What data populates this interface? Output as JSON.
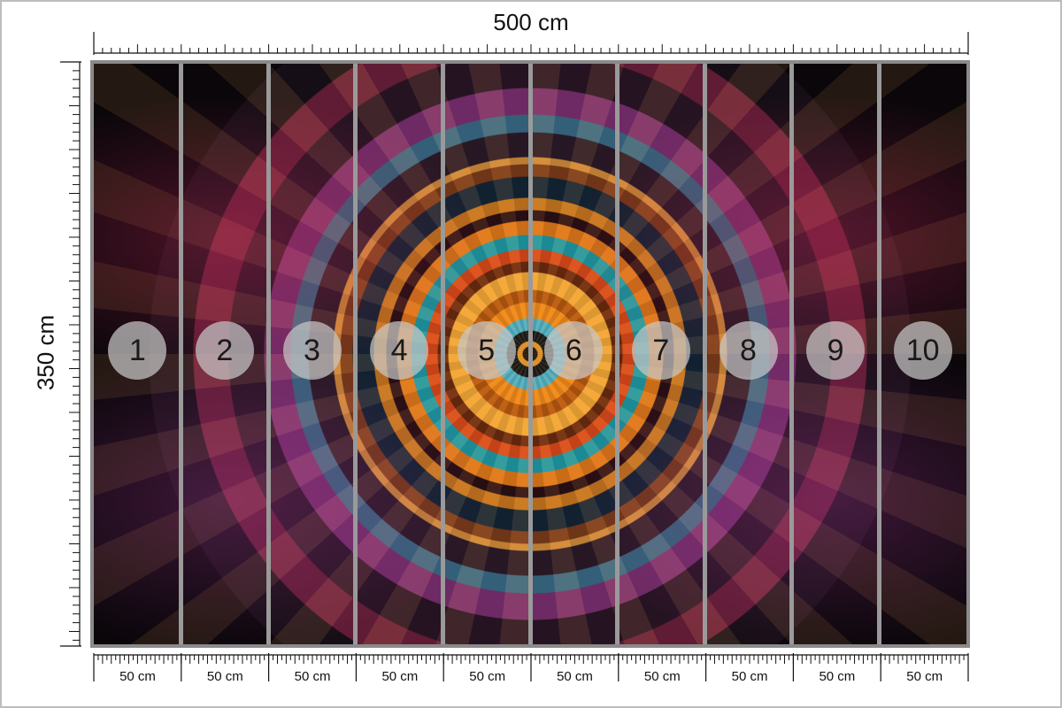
{
  "dimensions": {
    "width_label": "500 cm",
    "height_label": "350 cm"
  },
  "panels": [
    {
      "number": "1",
      "width_label": "50 cm"
    },
    {
      "number": "2",
      "width_label": "50 cm"
    },
    {
      "number": "3",
      "width_label": "50 cm"
    },
    {
      "number": "4",
      "width_label": "50 cm"
    },
    {
      "number": "5",
      "width_label": "50 cm"
    },
    {
      "number": "6",
      "width_label": "50 cm"
    },
    {
      "number": "7",
      "width_label": "50 cm"
    },
    {
      "number": "8",
      "width_label": "50 cm"
    },
    {
      "number": "9",
      "width_label": "50 cm"
    },
    {
      "number": "10",
      "width_label": "50 cm"
    }
  ],
  "colors": {
    "frame": "#8a8a8a",
    "divider": "#9a9a9a",
    "badge": "#c8c8c8",
    "ruler": "#111111"
  }
}
